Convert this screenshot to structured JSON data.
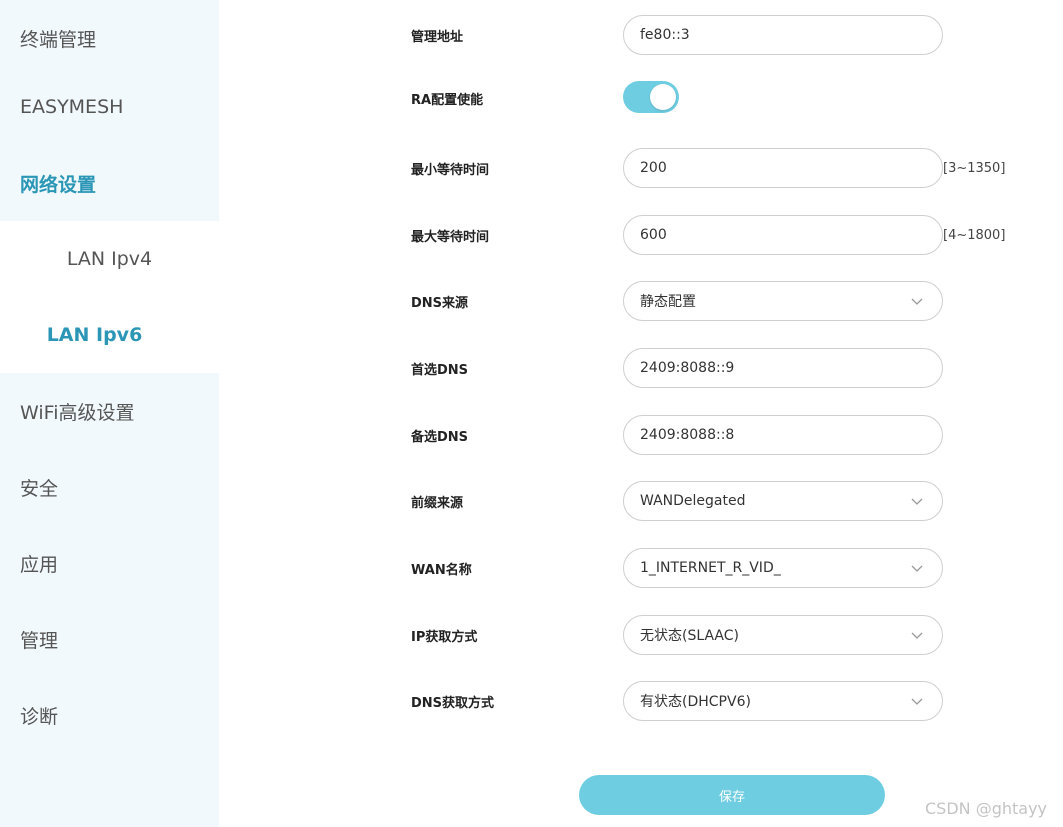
{
  "sidebar": {
    "items": [
      {
        "label": "终端管理"
      },
      {
        "label": "EASYMESH"
      },
      {
        "label": "网络设置",
        "active": true
      },
      {
        "label": "WiFi高级设置"
      },
      {
        "label": "安全"
      },
      {
        "label": "应用"
      },
      {
        "label": "管理"
      },
      {
        "label": "诊断"
      }
    ],
    "subitems": [
      {
        "label": "LAN Ipv4"
      },
      {
        "label": "LAN Ipv6",
        "active": true
      }
    ]
  },
  "form": {
    "mgmt_address": {
      "label": "管理地址",
      "value": "fe80::3"
    },
    "ra_enable": {
      "label": "RA配置使能",
      "on": true
    },
    "min_wait": {
      "label": "最小等待时间",
      "value": "200",
      "range": "[3~1350]"
    },
    "max_wait": {
      "label": "最大等待时间",
      "value": "600",
      "range": "[4~1800]"
    },
    "dns_source": {
      "label": "DNS来源",
      "value": "静态配置"
    },
    "primary_dns": {
      "label": "首选DNS",
      "value": "2409:8088::9"
    },
    "secondary_dns": {
      "label": "备选DNS",
      "value": "2409:8088::8"
    },
    "prefix_source": {
      "label": "前缀来源",
      "value": "WANDelegated"
    },
    "wan_name": {
      "label": "WAN名称",
      "value": "1_INTERNET_R_VID_"
    },
    "ip_mode": {
      "label": "IP获取方式",
      "value": "无状态(SLAAC)"
    },
    "dns_mode": {
      "label": "DNS获取方式",
      "value": "有状态(DHCPV6)"
    },
    "save_label": "保存"
  },
  "watermark": "CSDN @ghtayy",
  "colors": {
    "accent": "#2b96b6",
    "toggle_on": "#6fcde2",
    "sidebar_bg": "#f1f9fc"
  },
  "icons": {
    "select_arrow": "chevron-down-icon"
  }
}
